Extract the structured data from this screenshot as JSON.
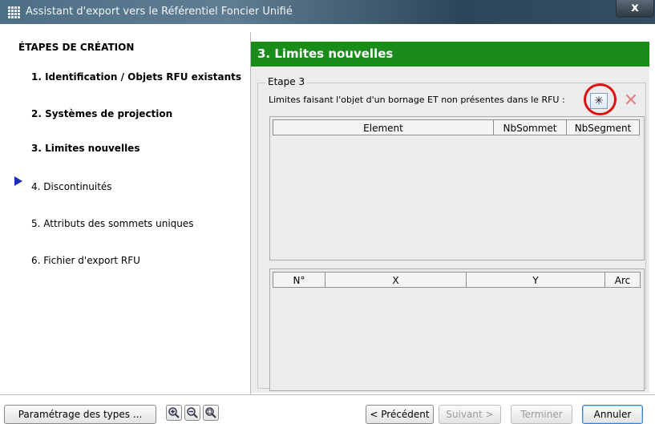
{
  "window": {
    "title": "Assistant d'export vers le Référentiel Foncier Unifié",
    "close_label": "x"
  },
  "sidebar": {
    "heading": "ÉTAPES DE CRÉATION",
    "steps": [
      {
        "label": "1. Identification / Objets RFU existants",
        "state": "done"
      },
      {
        "label": "2. Systèmes de projection",
        "state": "done"
      },
      {
        "label": "3. Limites nouvelles",
        "state": "current"
      },
      {
        "label": "4. Discontinuités",
        "state": "pending"
      },
      {
        "label": "5. Attributs des sommets uniques",
        "state": "pending"
      },
      {
        "label": "6. Fichier d'export RFU",
        "state": "pending"
      }
    ]
  },
  "panel": {
    "title": "3. Limites nouvelles",
    "group_label": "Etape 3",
    "description": "Limites faisant l'objet d'un bornage ET non présentes dans le RFU :",
    "add_icon": "asterisk-icon",
    "delete_icon": "delete-x-icon",
    "table_limits": {
      "columns": [
        "Element",
        "NbSommet",
        "NbSegment"
      ]
    },
    "table_points": {
      "columns": [
        "N°",
        "X",
        "Y",
        "Arc"
      ]
    }
  },
  "footer": {
    "settings_button": "Paramétrage des types ...",
    "zoom_in_icon": "zoom-in-icon",
    "zoom_out_icon": "zoom-out-icon",
    "zoom_fit_icon": "zoom-extent-icon",
    "prev_button": "< Précédent",
    "next_button": "Suivant >",
    "finish_button": "Terminer",
    "cancel_button": "Annuler"
  },
  "colors": {
    "header_green": "#1a8c1a",
    "current_arrow": "#1b2cc4",
    "highlight_ring": "#e01010"
  }
}
